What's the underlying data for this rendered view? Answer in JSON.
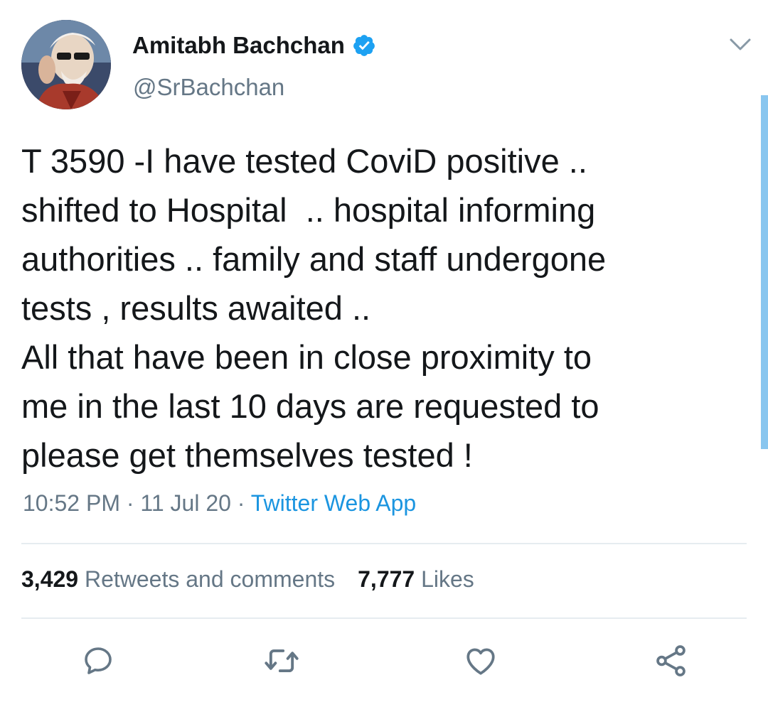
{
  "author": {
    "display_name": "Amitabh Bachchan",
    "handle": "@SrBachchan",
    "verified": true
  },
  "tweet": {
    "lines": [
      "T 3590 -I have tested CoviD positive ..",
      "shifted to Hospital  .. hospital informing",
      "authorities .. family and staff undergone",
      "tests , results awaited ..",
      "All that have been in close proximity to",
      "me in the last 10 days are requested to",
      "please get themselves tested !"
    ]
  },
  "meta": {
    "time": "10:52 PM",
    "separator": " · ",
    "date": "11 Jul 20",
    "source": "Twitter Web App"
  },
  "stats": {
    "retweets_count": "3,429",
    "retweets_label": "Retweets and comments",
    "likes_count": "7,777",
    "likes_label": "Likes"
  },
  "icons": {
    "reply": "reply-icon",
    "retweet": "retweet-icon",
    "like": "heart-icon",
    "share": "share-icon",
    "menu": "chevron-down-icon",
    "verified": "verified-badge-icon"
  },
  "colors": {
    "text": "#14171a",
    "secondary": "#657786",
    "link": "#1b95e0",
    "verified": "#1da1f2",
    "divider": "#e6ecf0"
  }
}
